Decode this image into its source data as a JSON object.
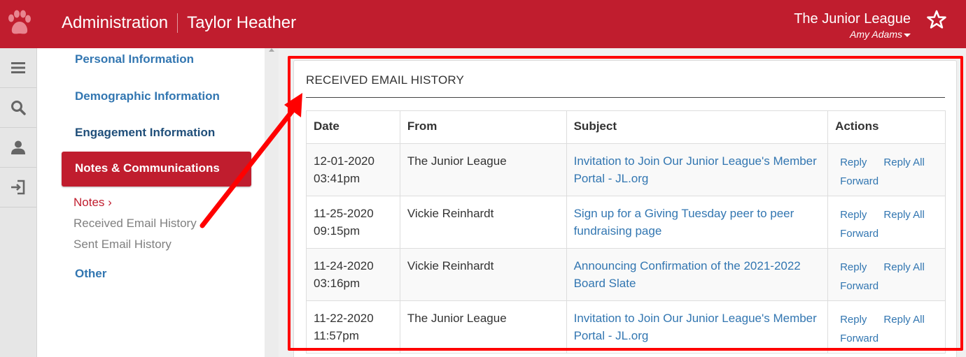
{
  "header": {
    "app_title": "Administration",
    "record_name": "Taylor Heather",
    "org_name": "The Junior League",
    "user_name": "Amy Adams",
    "logo_icon": "paw-icon",
    "favorite_icon": "star-icon",
    "color": "#c01d2e"
  },
  "rail": {
    "items": [
      {
        "icon": "menu-icon"
      },
      {
        "icon": "search-icon"
      },
      {
        "icon": "person-icon"
      },
      {
        "icon": "sign-in-icon"
      }
    ]
  },
  "subnav": {
    "personal": "Personal Information",
    "demographic": "Demographic Information",
    "engagement": "Engagement Information",
    "notes_comm": "Notes & Communications",
    "notes": "Notes",
    "notes_chevron": "›",
    "received": "Received Email History",
    "sent": "Sent Email History",
    "other": "Other"
  },
  "panel": {
    "title": "RECEIVED EMAIL HISTORY",
    "columns": [
      "Date",
      "From",
      "Subject",
      "Actions"
    ],
    "rows": [
      {
        "date": "12-01-2020",
        "time": "03:41pm",
        "from": "The Junior League",
        "subject": "Invitation to Join Our Junior League's Member Portal - JL.org"
      },
      {
        "date": "11-25-2020",
        "time": "09:15pm",
        "from": "Vickie Reinhardt",
        "subject": "Sign up for a Giving Tuesday peer to peer fundraising page"
      },
      {
        "date": "11-24-2020",
        "time": "03:16pm",
        "from": "Vickie Reinhardt",
        "subject": "Announcing Confirmation of the 2021-2022 Board Slate"
      },
      {
        "date": "11-22-2020",
        "time": "11:57pm",
        "from": "The Junior League",
        "subject": "Invitation to Join Our Junior League's Member Portal - JL.org"
      }
    ],
    "actions": {
      "reply": "Reply",
      "reply_all": "Reply All",
      "forward": "Forward"
    }
  },
  "annotation": {
    "color": "#ff0000"
  }
}
